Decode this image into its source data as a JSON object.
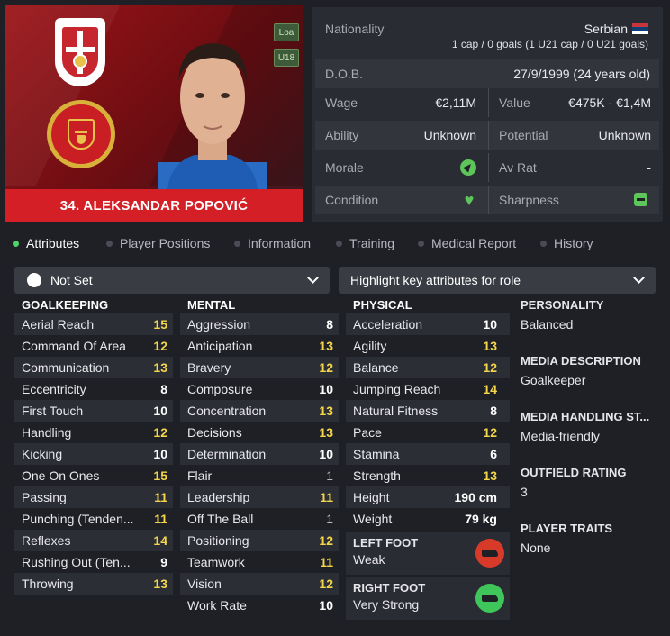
{
  "profile": {
    "tags": [
      "Loa",
      "U18"
    ],
    "name": "34. ALEKSANDAR POPOVIĆ"
  },
  "info": {
    "nationality_label": "Nationality",
    "nationality": "Serbian",
    "caps": "1 cap / 0 goals (1 U21 cap / 0 U21 goals)",
    "dob_label": "D.O.B.",
    "dob": "27/9/1999 (24 years old)",
    "wage_label": "Wage",
    "wage": "€2,11M",
    "value_label": "Value",
    "value": "€475K - €1,4M",
    "ability_label": "Ability",
    "ability": "Unknown",
    "potential_label": "Potential",
    "potential": "Unknown",
    "morale_label": "Morale",
    "avrat_label": "Av Rat",
    "avrat": "-",
    "condition_label": "Condition",
    "sharpness_label": "Sharpness"
  },
  "tabs": [
    "Attributes",
    "Player Positions",
    "Information",
    "Training",
    "Medical Report",
    "History"
  ],
  "dropdowns": {
    "role": "Not Set",
    "highlight": "Highlight key attributes for role"
  },
  "goalkeeping": {
    "title": "GOALKEEPING",
    "items": [
      {
        "name": "Aerial Reach",
        "value": "15"
      },
      {
        "name": "Command Of Area",
        "value": "12"
      },
      {
        "name": "Communication",
        "value": "13"
      },
      {
        "name": "Eccentricity",
        "value": "8"
      },
      {
        "name": "First Touch",
        "value": "10"
      },
      {
        "name": "Handling",
        "value": "12"
      },
      {
        "name": "Kicking",
        "value": "10"
      },
      {
        "name": "One On Ones",
        "value": "15"
      },
      {
        "name": "Passing",
        "value": "11"
      },
      {
        "name": "Punching (Tenden...",
        "value": "11"
      },
      {
        "name": "Reflexes",
        "value": "14"
      },
      {
        "name": "Rushing Out (Ten...",
        "value": "9"
      },
      {
        "name": "Throwing",
        "value": "13"
      }
    ]
  },
  "mental": {
    "title": "MENTAL",
    "items": [
      {
        "name": "Aggression",
        "value": "8"
      },
      {
        "name": "Anticipation",
        "value": "13"
      },
      {
        "name": "Bravery",
        "value": "12"
      },
      {
        "name": "Composure",
        "value": "10"
      },
      {
        "name": "Concentration",
        "value": "13"
      },
      {
        "name": "Decisions",
        "value": "13"
      },
      {
        "name": "Determination",
        "value": "10"
      },
      {
        "name": "Flair",
        "value": "1"
      },
      {
        "name": "Leadership",
        "value": "11"
      },
      {
        "name": "Off The Ball",
        "value": "1"
      },
      {
        "name": "Positioning",
        "value": "12"
      },
      {
        "name": "Teamwork",
        "value": "11"
      },
      {
        "name": "Vision",
        "value": "12"
      },
      {
        "name": "Work Rate",
        "value": "10"
      }
    ]
  },
  "physical": {
    "title": "PHYSICAL",
    "items": [
      {
        "name": "Acceleration",
        "value": "10"
      },
      {
        "name": "Agility",
        "value": "13"
      },
      {
        "name": "Balance",
        "value": "12"
      },
      {
        "name": "Jumping Reach",
        "value": "14"
      },
      {
        "name": "Natural Fitness",
        "value": "8"
      },
      {
        "name": "Pace",
        "value": "12"
      },
      {
        "name": "Stamina",
        "value": "6"
      },
      {
        "name": "Strength",
        "value": "13"
      },
      {
        "name": "Height",
        "value": "190 cm"
      },
      {
        "name": "Weight",
        "value": "79 kg"
      }
    ],
    "left_foot_label": "LEFT FOOT",
    "left_foot": "Weak",
    "right_foot_label": "RIGHT FOOT",
    "right_foot": "Very Strong"
  },
  "personal": {
    "personality_label": "PERSONALITY",
    "personality": "Balanced",
    "media_desc_label": "MEDIA DESCRIPTION",
    "media_desc": "Goalkeeper",
    "media_handling_label": "MEDIA HANDLING ST...",
    "media_handling": "Media-friendly",
    "outfield_label": "OUTFIELD RATING",
    "outfield": "3",
    "traits_label": "PLAYER TRAITS",
    "traits": "None"
  },
  "colors": {
    "high": "#ffffff",
    "good": "#f3d64a",
    "low": "#b9bac2",
    "accent_red": "#d41f26",
    "positive_green": "#5ec55b"
  }
}
